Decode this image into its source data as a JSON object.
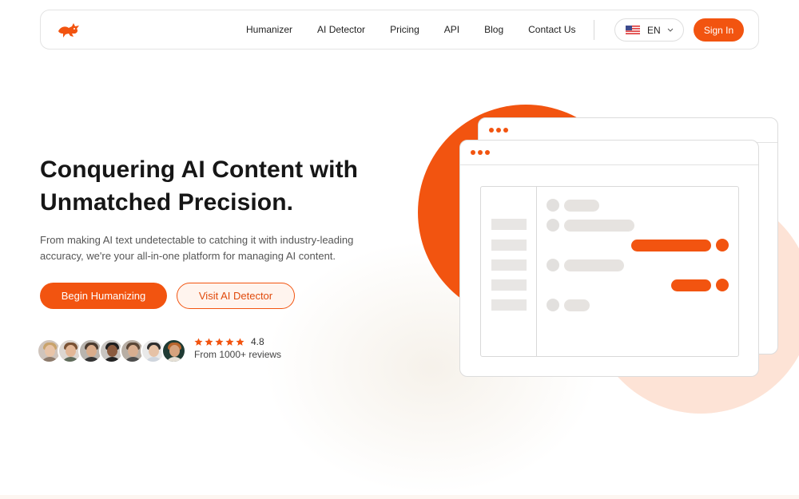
{
  "nav": {
    "links": [
      "Humanizer",
      "AI Detector",
      "Pricing",
      "API",
      "Blog",
      "Contact Us"
    ],
    "language": "EN",
    "signin_label": "Sign In"
  },
  "hero": {
    "title_line1": "Conquering AI Content with",
    "title_line2": "Unmatched Precision.",
    "description": "From making AI text undetectable to catching it with industry-leading accuracy, we're your all-in-one platform for managing AI content.",
    "primary_button": "Begin Humanizing",
    "secondary_button": "Visit AI Detector"
  },
  "social_proof": {
    "stars": 5,
    "rating": "4.8",
    "reviews": "From 1000+ reviews"
  },
  "colors": {
    "accent": "#f25410",
    "accent_soft": "#fde3d6",
    "placeholder_gray": "#e6e3e0"
  },
  "icons": {
    "logo": "fox-logo-icon",
    "flag": "us-flag-icon",
    "chevron": "chevron-down-icon",
    "star": "star-icon"
  }
}
